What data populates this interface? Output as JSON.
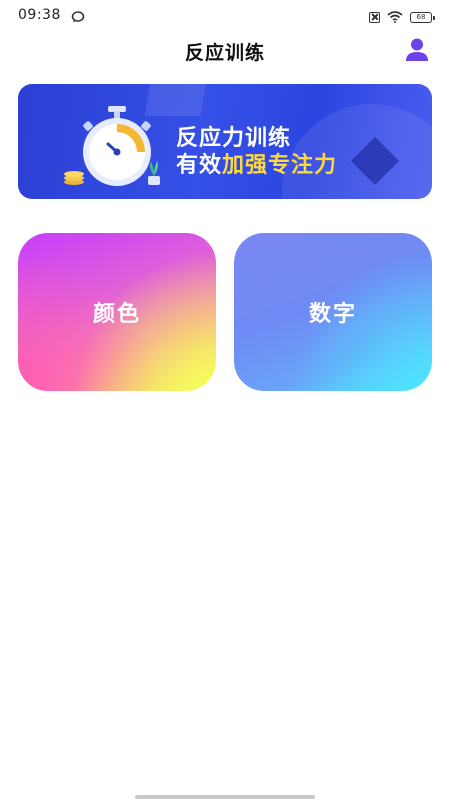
{
  "status_bar": {
    "time": "09:38",
    "battery_level": "68"
  },
  "header": {
    "title": "反应训练",
    "profile_icon": "person-icon"
  },
  "banner": {
    "line1": "反应力训练",
    "line2_prefix": "有效",
    "line2_highlight": "加强专注力",
    "illustration": "stopwatch-icon",
    "highlight_color": "#ffd83a"
  },
  "cards": [
    {
      "label": "颜色"
    },
    {
      "label": "数字"
    }
  ],
  "colors": {
    "accent_purple": "#6a44e8",
    "banner_blue": "#3550e6"
  }
}
